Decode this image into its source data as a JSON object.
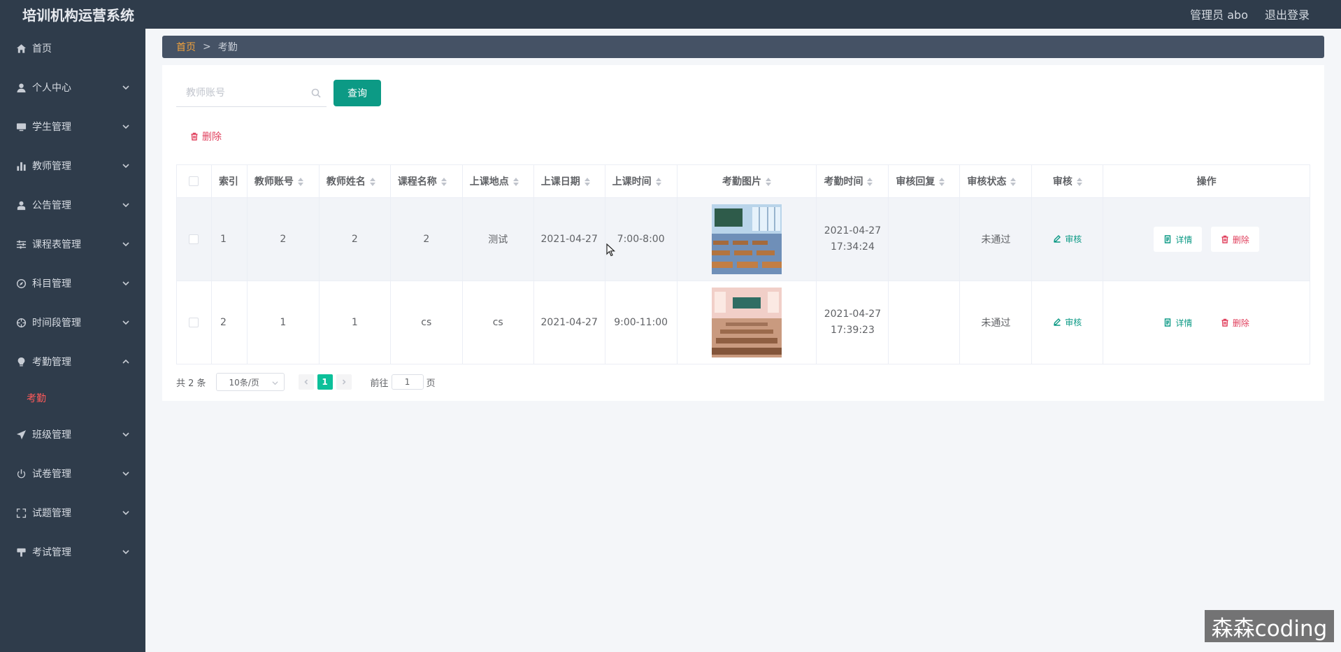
{
  "app": {
    "title": "培训机构运营系统",
    "user": "管理员 abo",
    "logout": "退出登录"
  },
  "sidebar": {
    "items": [
      {
        "label": "首页",
        "icon": "home-icon"
      },
      {
        "label": "个人中心",
        "icon": "user-icon"
      },
      {
        "label": "学生管理",
        "icon": "monitor-icon"
      },
      {
        "label": "教师管理",
        "icon": "bar-chart-icon"
      },
      {
        "label": "公告管理",
        "icon": "person-icon"
      },
      {
        "label": "课程表管理",
        "icon": "sliders-icon"
      },
      {
        "label": "科目管理",
        "icon": "compass-icon"
      },
      {
        "label": "时间段管理",
        "icon": "crosshair-icon"
      },
      {
        "label": "考勤管理",
        "icon": "bulb-icon"
      },
      {
        "label": "班级管理",
        "icon": "send-icon"
      },
      {
        "label": "试卷管理",
        "icon": "power-icon"
      },
      {
        "label": "试题管理",
        "icon": "fullscreen-icon"
      },
      {
        "label": "考试管理",
        "icon": "stamp-icon"
      }
    ],
    "active_sub": "考勤"
  },
  "breadcrumb": {
    "home": "首页",
    "sep": ">",
    "current": "考勤"
  },
  "search": {
    "placeholder": "教师账号",
    "button": "查询"
  },
  "toolbar": {
    "delete": "删除"
  },
  "table": {
    "headers": [
      "索引",
      "教师账号",
      "教师姓名",
      "课程名称",
      "上课地点",
      "上课日期",
      "上课时间",
      "考勤图片",
      "考勤时间",
      "审核回复",
      "审核状态",
      "审核",
      "操作"
    ],
    "rows": [
      {
        "index": "1",
        "account": "2",
        "name": "2",
        "course": "2",
        "place": "测试",
        "date": "2021-04-27",
        "time": "7:00-8:00",
        "att_date": "2021-04-27",
        "att_time": "17:34:24",
        "reply": "",
        "status": "未通过",
        "audit": "审核",
        "detail": "详情",
        "del": "删除"
      },
      {
        "index": "2",
        "account": "1",
        "name": "1",
        "course": "cs",
        "place": "cs",
        "date": "2021-04-27",
        "time": "9:00-11:00",
        "att_date": "2021-04-27",
        "att_time": "17:39:23",
        "reply": "",
        "status": "未通过",
        "audit": "审核",
        "detail": "详情",
        "del": "删除"
      }
    ]
  },
  "pager": {
    "total": "共 2 条",
    "size": "10条/页",
    "current": "1",
    "goto_label": "前往",
    "goto_value": "1",
    "page_unit": "页"
  },
  "watermark": "森森coding",
  "colors": {
    "sidebar": "#2f3c4b",
    "accent": "#0c9a85",
    "danger": "#e0405d",
    "breadcrumb_home": "#f0a13c"
  }
}
